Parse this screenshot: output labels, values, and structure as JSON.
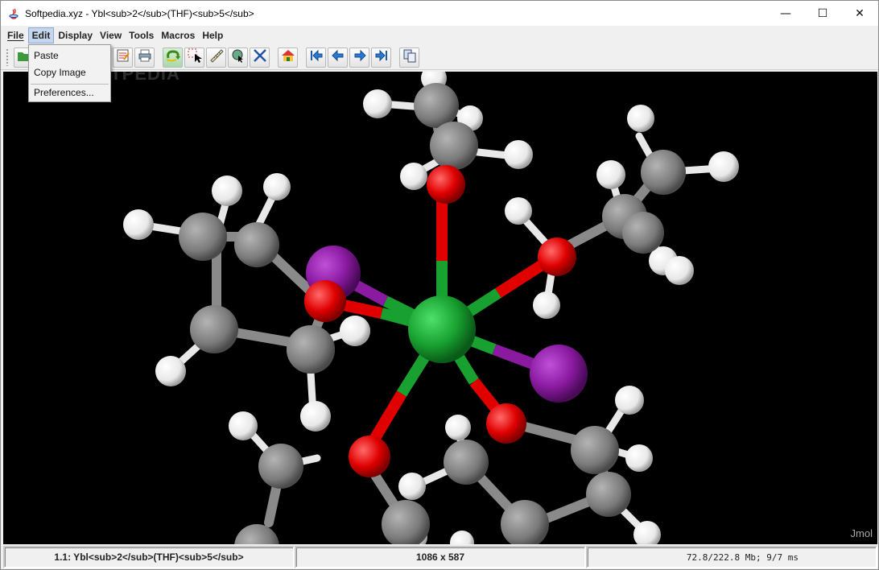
{
  "window": {
    "title": "Softpedia.xyz - Ybl<sub>2</sub>(THF)<sub>5</sub>",
    "minimize": "—",
    "maximize": "☐",
    "close": "✕"
  },
  "menubar": {
    "items": [
      "File",
      "Edit",
      "Display",
      "View",
      "Tools",
      "Macros",
      "Help"
    ],
    "active": "Edit"
  },
  "edit_menu": {
    "items": [
      "Paste",
      "Copy Image",
      "Preferences..."
    ]
  },
  "toolbar": {
    "buttons": [
      "open-icon",
      "script-editor-icon",
      "print-icon",
      "rotate-icon",
      "select-icon",
      "measure-icon",
      "pick-center-icon",
      "translate-icon",
      "home-icon",
      "first-frame-icon",
      "previous-frame-icon",
      "next-frame-icon",
      "last-frame-icon",
      "copy-icon"
    ]
  },
  "viewer": {
    "watermark": "SOFTPEDIA",
    "label": "Jmol",
    "background": "#000000",
    "atom_colors": {
      "Yb": "#1aa336",
      "O": "#ee0000",
      "C": "#8c8c8c",
      "H": "#ffffff",
      "I": "#8a1aa0"
    }
  },
  "status": {
    "model": "1.1: Ybl<sub>2</sub>(THF)<sub>5</sub>",
    "size": "1086 x 587",
    "memory": "72.8/222.8 Mb;    9/7 ms"
  }
}
